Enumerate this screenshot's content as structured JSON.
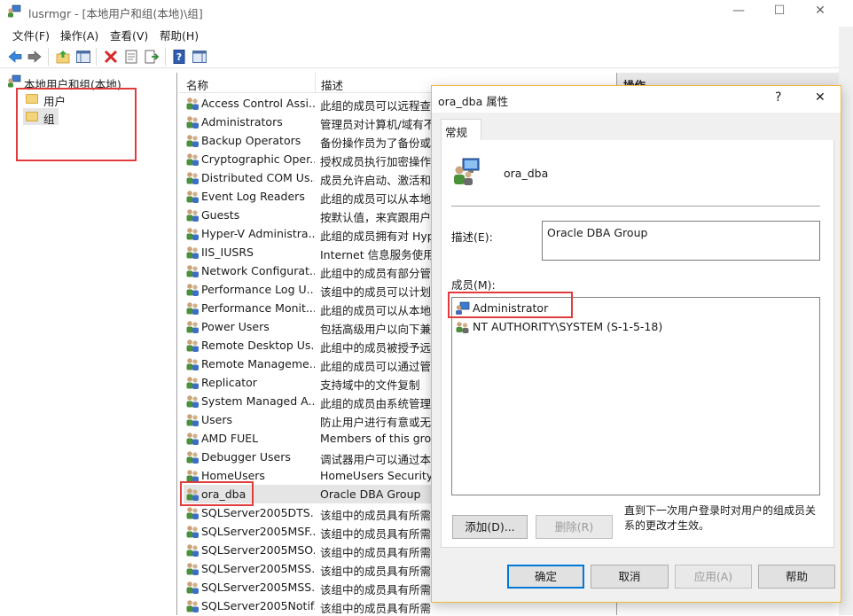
{
  "window": {
    "title": "lusrmgr - [本地用户和组(本地)\\组]",
    "controls": [
      "—",
      "☐",
      "✕"
    ]
  },
  "menu": [
    "文件(F)",
    "操作(A)",
    "查看(V)",
    "帮助(H)"
  ],
  "tree": {
    "root": "本地用户和组(本地)",
    "children": [
      "用户",
      "组"
    ]
  },
  "list": {
    "columns": [
      "名称",
      "描述"
    ],
    "rows": [
      {
        "name": "Access Control Assi...",
        "desc": "此组的成员可以远程查询"
      },
      {
        "name": "Administrators",
        "desc": "管理员对计算机/域有不"
      },
      {
        "name": "Backup Operators",
        "desc": "备份操作员为了备份或还"
      },
      {
        "name": "Cryptographic Oper...",
        "desc": "授权成员执行加密操作。"
      },
      {
        "name": "Distributed COM Us...",
        "desc": "成员允许启动、激活和使"
      },
      {
        "name": "Event Log Readers",
        "desc": "此组的成员可以从本地计"
      },
      {
        "name": "Guests",
        "desc": "按默认值，来宾跟用户组"
      },
      {
        "name": "Hyper-V Administra...",
        "desc": "此组的成员拥有对 Hyper"
      },
      {
        "name": "IIS_IUSRS",
        "desc": "Internet 信息服务使用的"
      },
      {
        "name": "Network Configurat...",
        "desc": "此组中的成员有部分管理"
      },
      {
        "name": "Performance Log U...",
        "desc": "该组中的成员可以计划进"
      },
      {
        "name": "Performance Monit...",
        "desc": "此组的成员可以从本地和"
      },
      {
        "name": "Power Users",
        "desc": "包括高级用户以向下兼容"
      },
      {
        "name": "Remote Desktop Us...",
        "desc": "此组中的成员被授予远程"
      },
      {
        "name": "Remote Manageme...",
        "desc": "此组的成员可以通过管理"
      },
      {
        "name": "Replicator",
        "desc": "支持域中的文件复制"
      },
      {
        "name": "System Managed A...",
        "desc": "此组的成员由系统管理。"
      },
      {
        "name": "Users",
        "desc": "防止用户进行有意或无意"
      },
      {
        "name": "AMD FUEL",
        "desc": "Members of this group"
      },
      {
        "name": "Debugger Users",
        "desc": "调试器用户可以通过本地"
      },
      {
        "name": "HomeUsers",
        "desc": "HomeUsers Security G"
      },
      {
        "name": "ora_dba",
        "desc": "Oracle DBA Group"
      },
      {
        "name": "SQLServer2005DTS...",
        "desc": "该组中的成员具有所需的"
      },
      {
        "name": "SQLServer2005MSF...",
        "desc": "该组中的成员具有所需的"
      },
      {
        "name": "SQLServer2005MSO...",
        "desc": "该组中的成员具有所需的"
      },
      {
        "name": "SQLServer2005MSS...",
        "desc": "该组中的成员具有所需的"
      },
      {
        "name": "SQLServer2005MSS...",
        "desc": "该组中的成员具有所需的"
      },
      {
        "name": "SQLServer2005Notif...",
        "desc": "该组中的成员具有所需的访问权..."
      }
    ],
    "selected_index": 21
  },
  "actions": {
    "header": "操作"
  },
  "dialog": {
    "title": "ora_dba 属性",
    "help_glyph": "?",
    "close_glyph": "✕",
    "tab": "常规",
    "group_name": "ora_dba",
    "desc_label": "描述(E):",
    "desc_value": "Oracle DBA Group",
    "members_label": "成员(M):",
    "members": [
      "Administrator",
      "NT AUTHORITY\\SYSTEM (S-1-5-18)"
    ],
    "add_button": "添加(D)...",
    "remove_button": "删除(R)",
    "note": "直到下一次用户登录时对用户的组成员关系的更改才生效。",
    "ok_button": "确定",
    "cancel_button": "取消",
    "apply_button": "应用(A)",
    "help_button": "帮助"
  },
  "colors": {
    "highlight_box": "#e23b3b",
    "dialog_border": "#f0b840",
    "primary_button_border": "#0078d7"
  }
}
